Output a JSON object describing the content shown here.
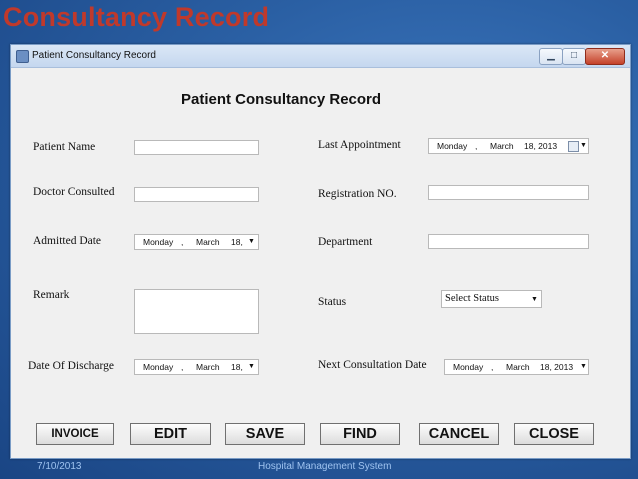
{
  "slide": {
    "title": "Consultancy Record",
    "footer_date": "7/10/2013",
    "footer_text": "Hospital Management System"
  },
  "window": {
    "title": "Patient Consultancy Record",
    "controls": {
      "minimize": "▁",
      "maximize": "□",
      "close": "✕"
    }
  },
  "form": {
    "heading": "Patient Consultancy Record",
    "labels": {
      "patient_name": "Patient Name",
      "doctor_consulted": "Doctor Consulted",
      "admitted_date": "Admitted Date",
      "remark": "Remark",
      "date_of_discharge": "Date Of Discharge",
      "last_appointment": "Last Appointment",
      "registration_no": "Registration NO.",
      "department": "Department",
      "status": "Status",
      "next_consultation_date": "Next Consultation Date"
    },
    "values": {
      "patient_name": "",
      "doctor_consulted": "",
      "remark": "",
      "registration_no": "",
      "department": ""
    },
    "dates": {
      "admitted": {
        "weekday": "Monday",
        "sep": ",",
        "month": "March",
        "day": "18,",
        "arrow": "▼"
      },
      "discharge": {
        "weekday": "Monday",
        "sep": ",",
        "month": "March",
        "day": "18,",
        "arrow": "▼"
      },
      "last_appointment": {
        "weekday": "Monday",
        "sep": ",",
        "month": "March",
        "day": "18, 2013",
        "arrow": "▼"
      },
      "next_consultation": {
        "weekday": "Monday",
        "sep": ",",
        "month": "March",
        "day": "18, 2013",
        "arrow": "▼"
      }
    },
    "status_select": {
      "selected": "Select Status",
      "arrow": "▼"
    }
  },
  "buttons": {
    "invoice": "INVOICE",
    "edit": "EDIT",
    "save": "SAVE",
    "find": "FIND",
    "cancel": "CANCEL",
    "close": "CLOSE"
  },
  "icons": {
    "app": "form-icon",
    "calendar": "calendar-icon"
  },
  "colors": {
    "slide_title": "#c0392b",
    "slide_background": "#2a5fa3",
    "window_background": "#f0f0f0",
    "close_button": "#c4412a"
  }
}
